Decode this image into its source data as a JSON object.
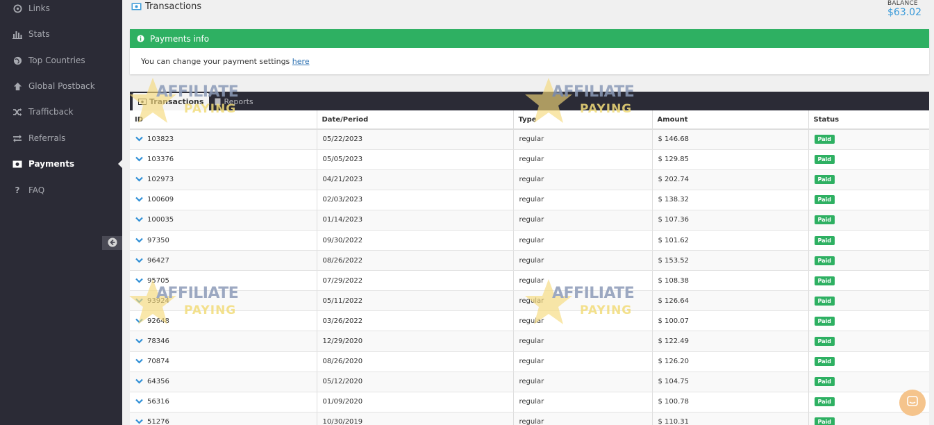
{
  "sidebar": {
    "items": [
      {
        "label": "Links",
        "icon": "link-icon",
        "active": false
      },
      {
        "label": "Stats",
        "icon": "bar-chart-icon",
        "active": false
      },
      {
        "label": "Top Countries",
        "icon": "globe-icon",
        "active": false
      },
      {
        "label": "Global Postback",
        "icon": "arrow-up-icon",
        "active": false
      },
      {
        "label": "Trafficback",
        "icon": "shuffle-icon",
        "active": false
      },
      {
        "label": "Referrals",
        "icon": "exchange-icon",
        "active": false
      },
      {
        "label": "Payments",
        "icon": "money-icon",
        "active": true
      },
      {
        "label": "FAQ",
        "icon": "question-icon",
        "active": false
      }
    ]
  },
  "header": {
    "title": "Transactions",
    "balance_label": "BALANCE",
    "balance_value": "$63.02"
  },
  "info": {
    "title": "Payments info",
    "text": "You can change your payment settings ",
    "link": "here"
  },
  "tabs": [
    {
      "label": "Transactions",
      "active": true
    },
    {
      "label": "Reports",
      "active": false
    }
  ],
  "table": {
    "columns": [
      "ID",
      "Date/Period",
      "Type",
      "Amount",
      "Status"
    ],
    "rows": [
      {
        "id": "103823",
        "date": "05/22/2023",
        "type": "regular",
        "amount": "$ 146.68",
        "status": "Paid"
      },
      {
        "id": "103376",
        "date": "05/05/2023",
        "type": "regular",
        "amount": "$ 129.85",
        "status": "Paid"
      },
      {
        "id": "102973",
        "date": "04/21/2023",
        "type": "regular",
        "amount": "$ 202.74",
        "status": "Paid"
      },
      {
        "id": "100609",
        "date": "02/03/2023",
        "type": "regular",
        "amount": "$ 138.32",
        "status": "Paid"
      },
      {
        "id": "100035",
        "date": "01/14/2023",
        "type": "regular",
        "amount": "$ 107.36",
        "status": "Paid"
      },
      {
        "id": "97350",
        "date": "09/30/2022",
        "type": "regular",
        "amount": "$ 101.62",
        "status": "Paid"
      },
      {
        "id": "96427",
        "date": "08/26/2022",
        "type": "regular",
        "amount": "$ 153.52",
        "status": "Paid"
      },
      {
        "id": "95705",
        "date": "07/29/2022",
        "type": "regular",
        "amount": "$ 108.38",
        "status": "Paid"
      },
      {
        "id": "93924",
        "date": "05/11/2022",
        "type": "regular",
        "amount": "$ 126.64",
        "status": "Paid"
      },
      {
        "id": "92648",
        "date": "03/26/2022",
        "type": "regular",
        "amount": "$ 100.07",
        "status": "Paid"
      },
      {
        "id": "78346",
        "date": "12/29/2020",
        "type": "regular",
        "amount": "$ 122.49",
        "status": "Paid"
      },
      {
        "id": "70874",
        "date": "08/26/2020",
        "type": "regular",
        "amount": "$ 126.20",
        "status": "Paid"
      },
      {
        "id": "64356",
        "date": "05/12/2020",
        "type": "regular",
        "amount": "$ 104.75",
        "status": "Paid"
      },
      {
        "id": "56316",
        "date": "01/09/2020",
        "type": "regular",
        "amount": "$ 100.78",
        "status": "Paid"
      },
      {
        "id": "51276",
        "date": "10/30/2019",
        "type": "regular",
        "amount": "$ 110.31",
        "status": "Paid"
      }
    ]
  },
  "watermark": {
    "line1": "AFFILIATE",
    "line2": "PAYING"
  },
  "colors": {
    "sidebar_bg": "#2b2b36",
    "green": "#2eb062",
    "accent_blue": "#3a9ad9",
    "badge_green": "#2eb062"
  }
}
